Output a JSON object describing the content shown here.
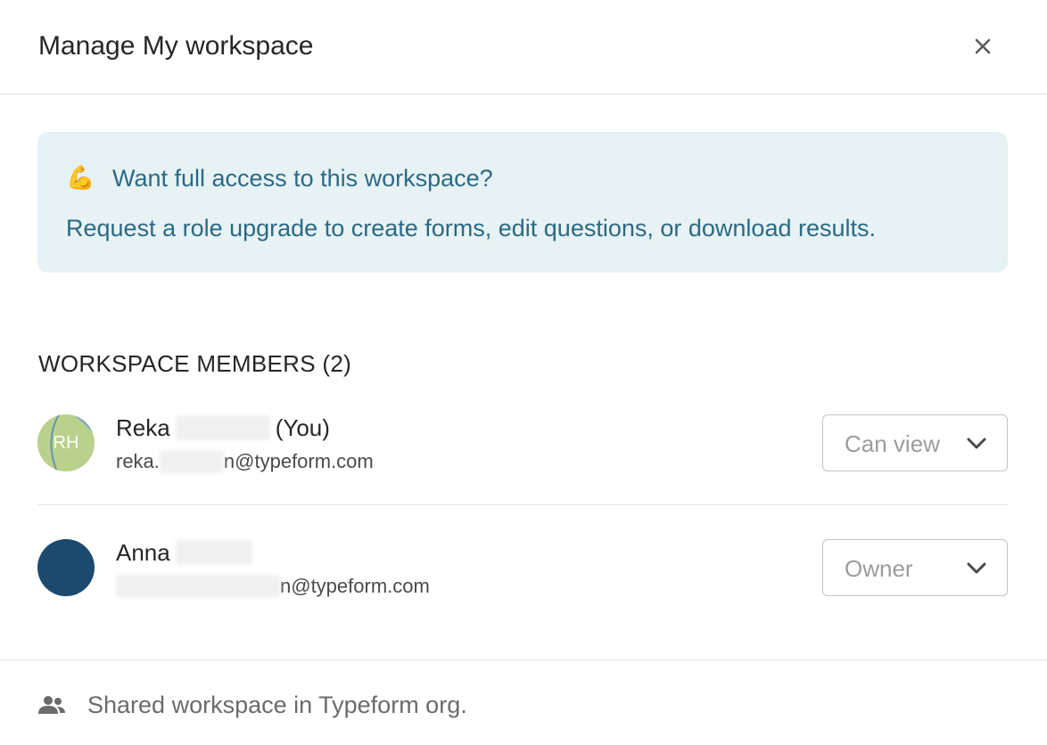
{
  "dialog": {
    "title": "Manage My workspace",
    "close_icon": "close-icon"
  },
  "banner": {
    "icon": "flexed-biceps-emoji",
    "emoji": "💪",
    "title": "Want full access to this workspace?",
    "text": "Request a role upgrade to create forms, edit questions, or download results."
  },
  "members": {
    "heading": "WORKSPACE MEMBERS (2)",
    "items": [
      {
        "initials": "RH",
        "first_name": "Reka",
        "suffix": "(You)",
        "email_prefix": "reka.",
        "email_suffix": "n@typeform.com",
        "role": "Can view",
        "avatar_color": "#b9d18c"
      },
      {
        "initials": "",
        "first_name": "Anna",
        "suffix": "",
        "email_prefix": "",
        "email_suffix": "n@typeform.com",
        "role": "Owner",
        "avatar_color": "#1c4a6e"
      }
    ]
  },
  "footer": {
    "icon": "people-icon",
    "text": "Shared workspace in Typeform org."
  },
  "colors": {
    "banner_bg": "#e7f2f4",
    "banner_text": "#2b6a85",
    "divider": "#e3e3e3"
  }
}
